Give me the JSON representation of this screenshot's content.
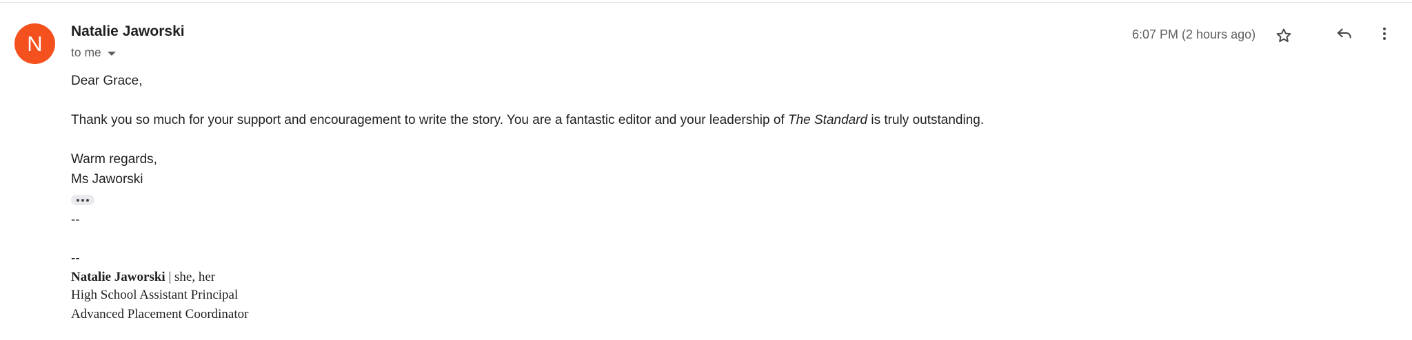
{
  "sender": {
    "avatar_letter": "N",
    "avatar_color": "#f4511e",
    "name": "Natalie Jaworski"
  },
  "recipient_label": "to me",
  "timestamp": "6:07 PM (2 hours ago)",
  "actions": {
    "star_icon": "star-outline-icon",
    "reply_icon": "reply-icon",
    "more_icon": "more-vertical-icon"
  },
  "message": {
    "greeting": "Dear Grace,",
    "paragraph_before": "Thank you so much for your support and encouragement to write the story. You are a fantastic editor and your leadership of ",
    "paragraph_italic": "The Standard",
    "paragraph_after": " is truly outstanding.",
    "signoff": "Warm regards,",
    "signoff_name": "Ms Jaworski",
    "separator_1": "--",
    "separator_2": "--"
  },
  "signature": {
    "name": "Natalie Jaworski",
    "pronouns": " | she, her",
    "title": "High School Assistant Principal",
    "role": "Advanced Placement Coordinator"
  }
}
